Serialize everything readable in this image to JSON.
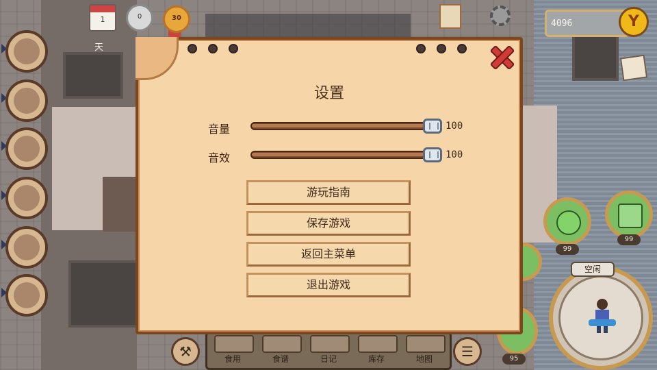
{
  "hud": {
    "calendar_day": "1",
    "day_label": "天",
    "clock_value": "0",
    "medal_value": "30",
    "money": "4096",
    "coin_symbol": "Y"
  },
  "settings": {
    "title": "设置",
    "volume": {
      "label": "音量",
      "value": 100,
      "display": "100"
    },
    "sfx": {
      "label": "音效",
      "value": 100,
      "display": "100"
    },
    "menu": [
      {
        "label": "游玩指南"
      },
      {
        "label": "保存游戏"
      },
      {
        "label": "返回主菜单"
      },
      {
        "label": "退出游戏"
      }
    ]
  },
  "bottom_bar": {
    "tabs": [
      {
        "label": "食用"
      },
      {
        "label": "食谱"
      },
      {
        "label": "日记"
      },
      {
        "label": "库存"
      },
      {
        "label": "地图"
      }
    ]
  },
  "status": {
    "mood_value": "99",
    "energy_value": "99",
    "hunger_value": "99",
    "health_value": "95",
    "state_label": "空闲"
  },
  "colors": {
    "panel": "#f6d6a8",
    "panel_border": "#7a4720",
    "close_red": "#d23a36",
    "slider_track": "#7c4a2c"
  }
}
